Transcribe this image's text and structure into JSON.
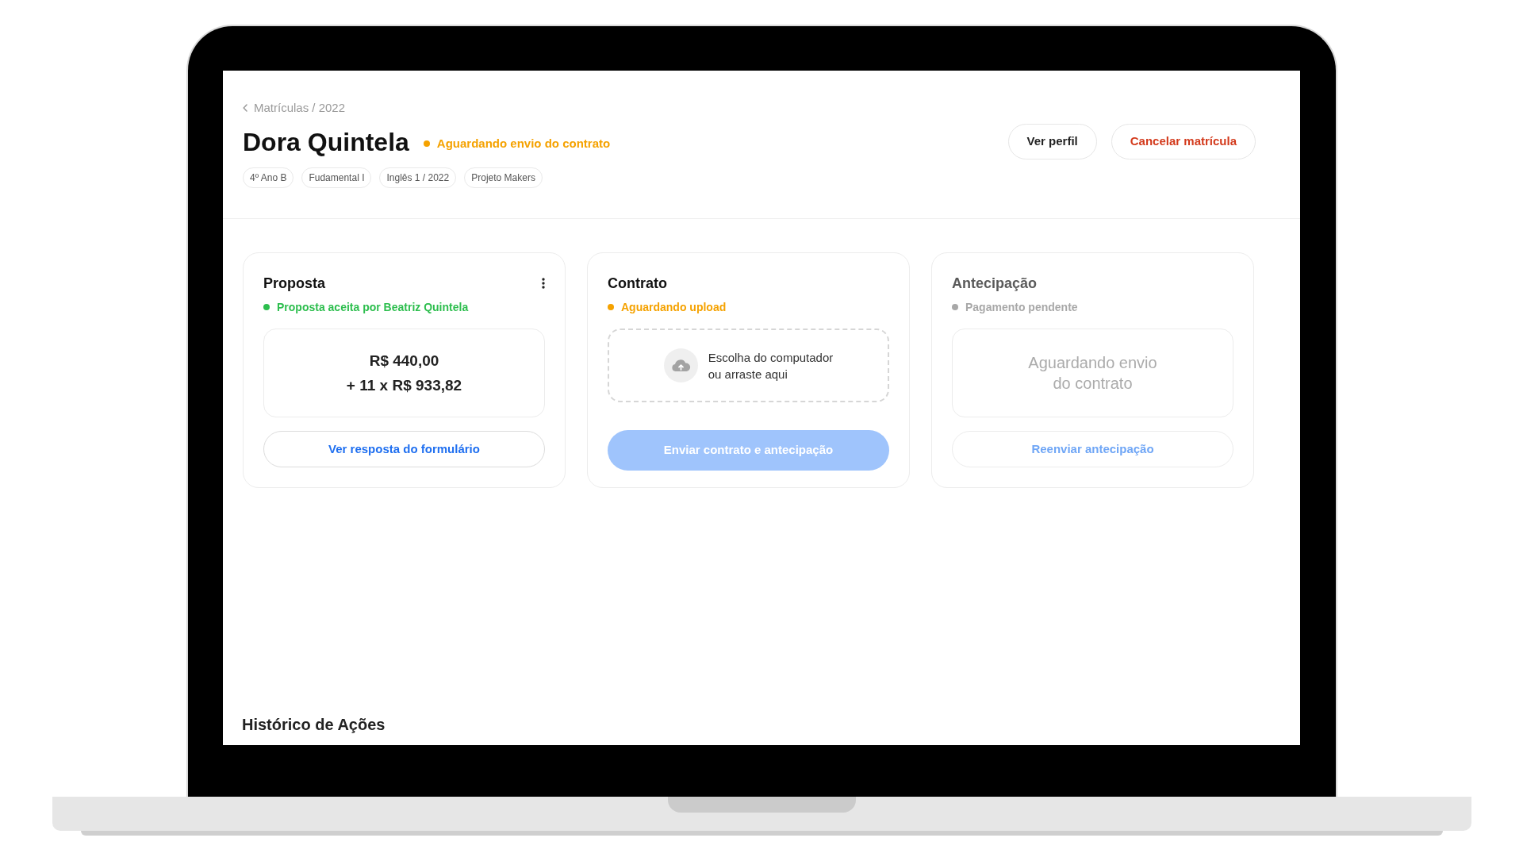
{
  "breadcrumb": {
    "label": "Matrículas / 2022"
  },
  "header": {
    "title": "Dora Quintela",
    "status": {
      "label": "Aguardando envio do contrato",
      "color": "#f5a200"
    },
    "tags": [
      "4º Ano B",
      "Fudamental I",
      "Inglês 1 / 2022",
      "Projeto Makers"
    ],
    "buttons": [
      {
        "label": "Ver perfil",
        "kind": "default"
      },
      {
        "label": "Cancelar matrícula",
        "kind": "danger"
      }
    ]
  },
  "cards": [
    {
      "kind": "amount",
      "title": "Proposta",
      "menu": true,
      "dimmed": false,
      "status": {
        "label": "Proposta aceita por Beatriz Quintela",
        "color": "#2dbe4e"
      },
      "amounts": [
        "R$ 440,00",
        "+ 11 x R$ 933,82"
      ],
      "button": {
        "label": "Ver resposta do formulário",
        "kind": "outline",
        "disabled": false
      }
    },
    {
      "kind": "upload",
      "title": "Contrato",
      "menu": false,
      "dimmed": false,
      "status": {
        "label": "Aguardando upload",
        "color": "#f5a200"
      },
      "upload_hint": "Escolha do computador\nou arraste aqui",
      "button": {
        "label": "Enviar contrato e antecipação",
        "kind": "filled",
        "disabled": true
      }
    },
    {
      "kind": "message",
      "title": "Antecipação",
      "menu": false,
      "dimmed": true,
      "status": {
        "label": "Pagamento pendente",
        "color": "#a8a8a8"
      },
      "message": "Aguardando envio\ndo contrato",
      "button": {
        "label": "Reenviar antecipação",
        "kind": "outline",
        "disabled": false
      }
    }
  ],
  "history": {
    "title": "Histórico de Ações"
  }
}
